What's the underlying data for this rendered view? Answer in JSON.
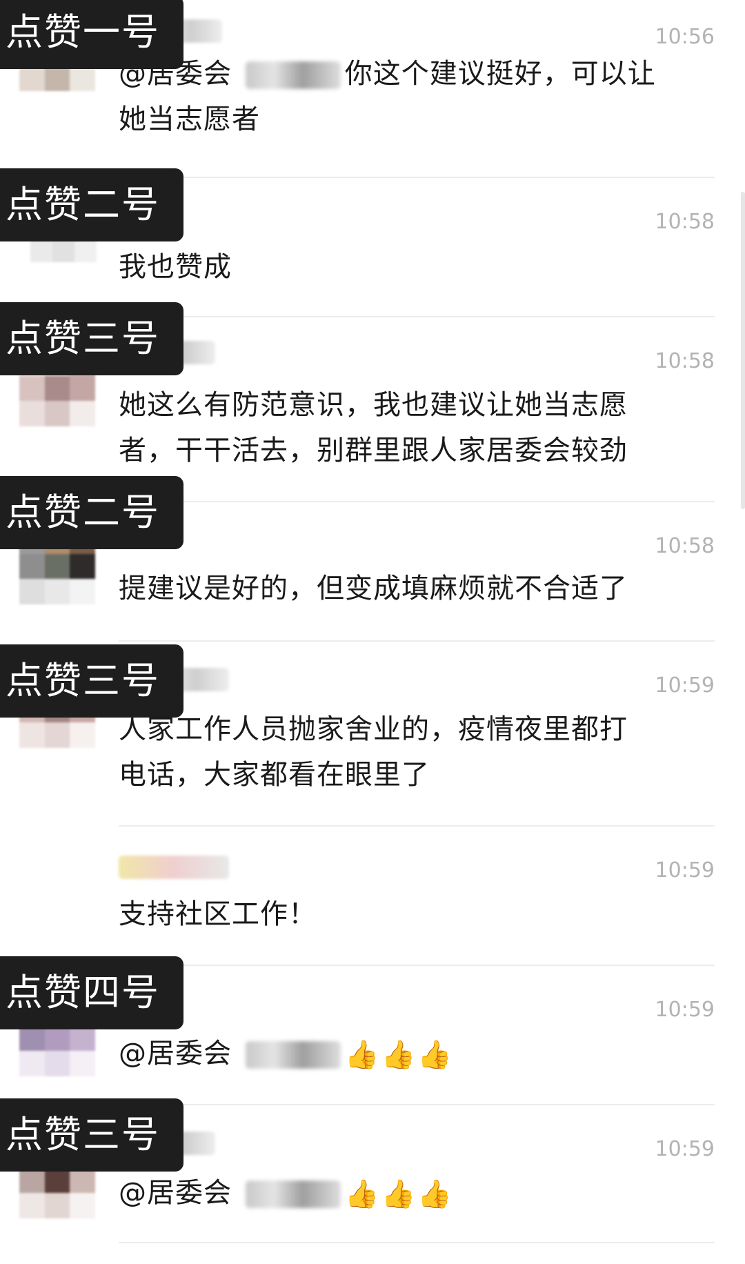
{
  "messages": [
    {
      "time": "10:56",
      "tag": "点赞一号",
      "lines": [
        "@居委会 ",
        "你这个建议挺好，可以让",
        "她当志愿者"
      ]
    },
    {
      "time": "10:58",
      "tag": "点赞二号",
      "lines": [
        "我也赞成"
      ]
    },
    {
      "time": "10:58",
      "tag": "点赞三号",
      "lines": [
        "她这么有防范意识，我也建议让她当志愿",
        "者，干干活去，别群里跟人家居委会较劲"
      ]
    },
    {
      "time": "10:58",
      "tag": "点赞二号",
      "lines": [
        "提建议是好的，但变成填麻烦就不合适了"
      ]
    },
    {
      "time": "10:59",
      "tag": "点赞三号",
      "lines": [
        "人家工作人员抛家舍业的，疫情夜里都打",
        "电话，大家都看在眼里了"
      ]
    },
    {
      "time": "10:59",
      "tag": "",
      "lines": [
        "支持社区工作！"
      ]
    },
    {
      "time": "10:59",
      "tag": "点赞四号",
      "lines": [
        "@居委会 "
      ]
    },
    {
      "time": "10:59",
      "tag": "点赞三号",
      "lines": [
        "@居委会 "
      ]
    }
  ],
  "icons": {
    "thumbs_up": "👍"
  }
}
